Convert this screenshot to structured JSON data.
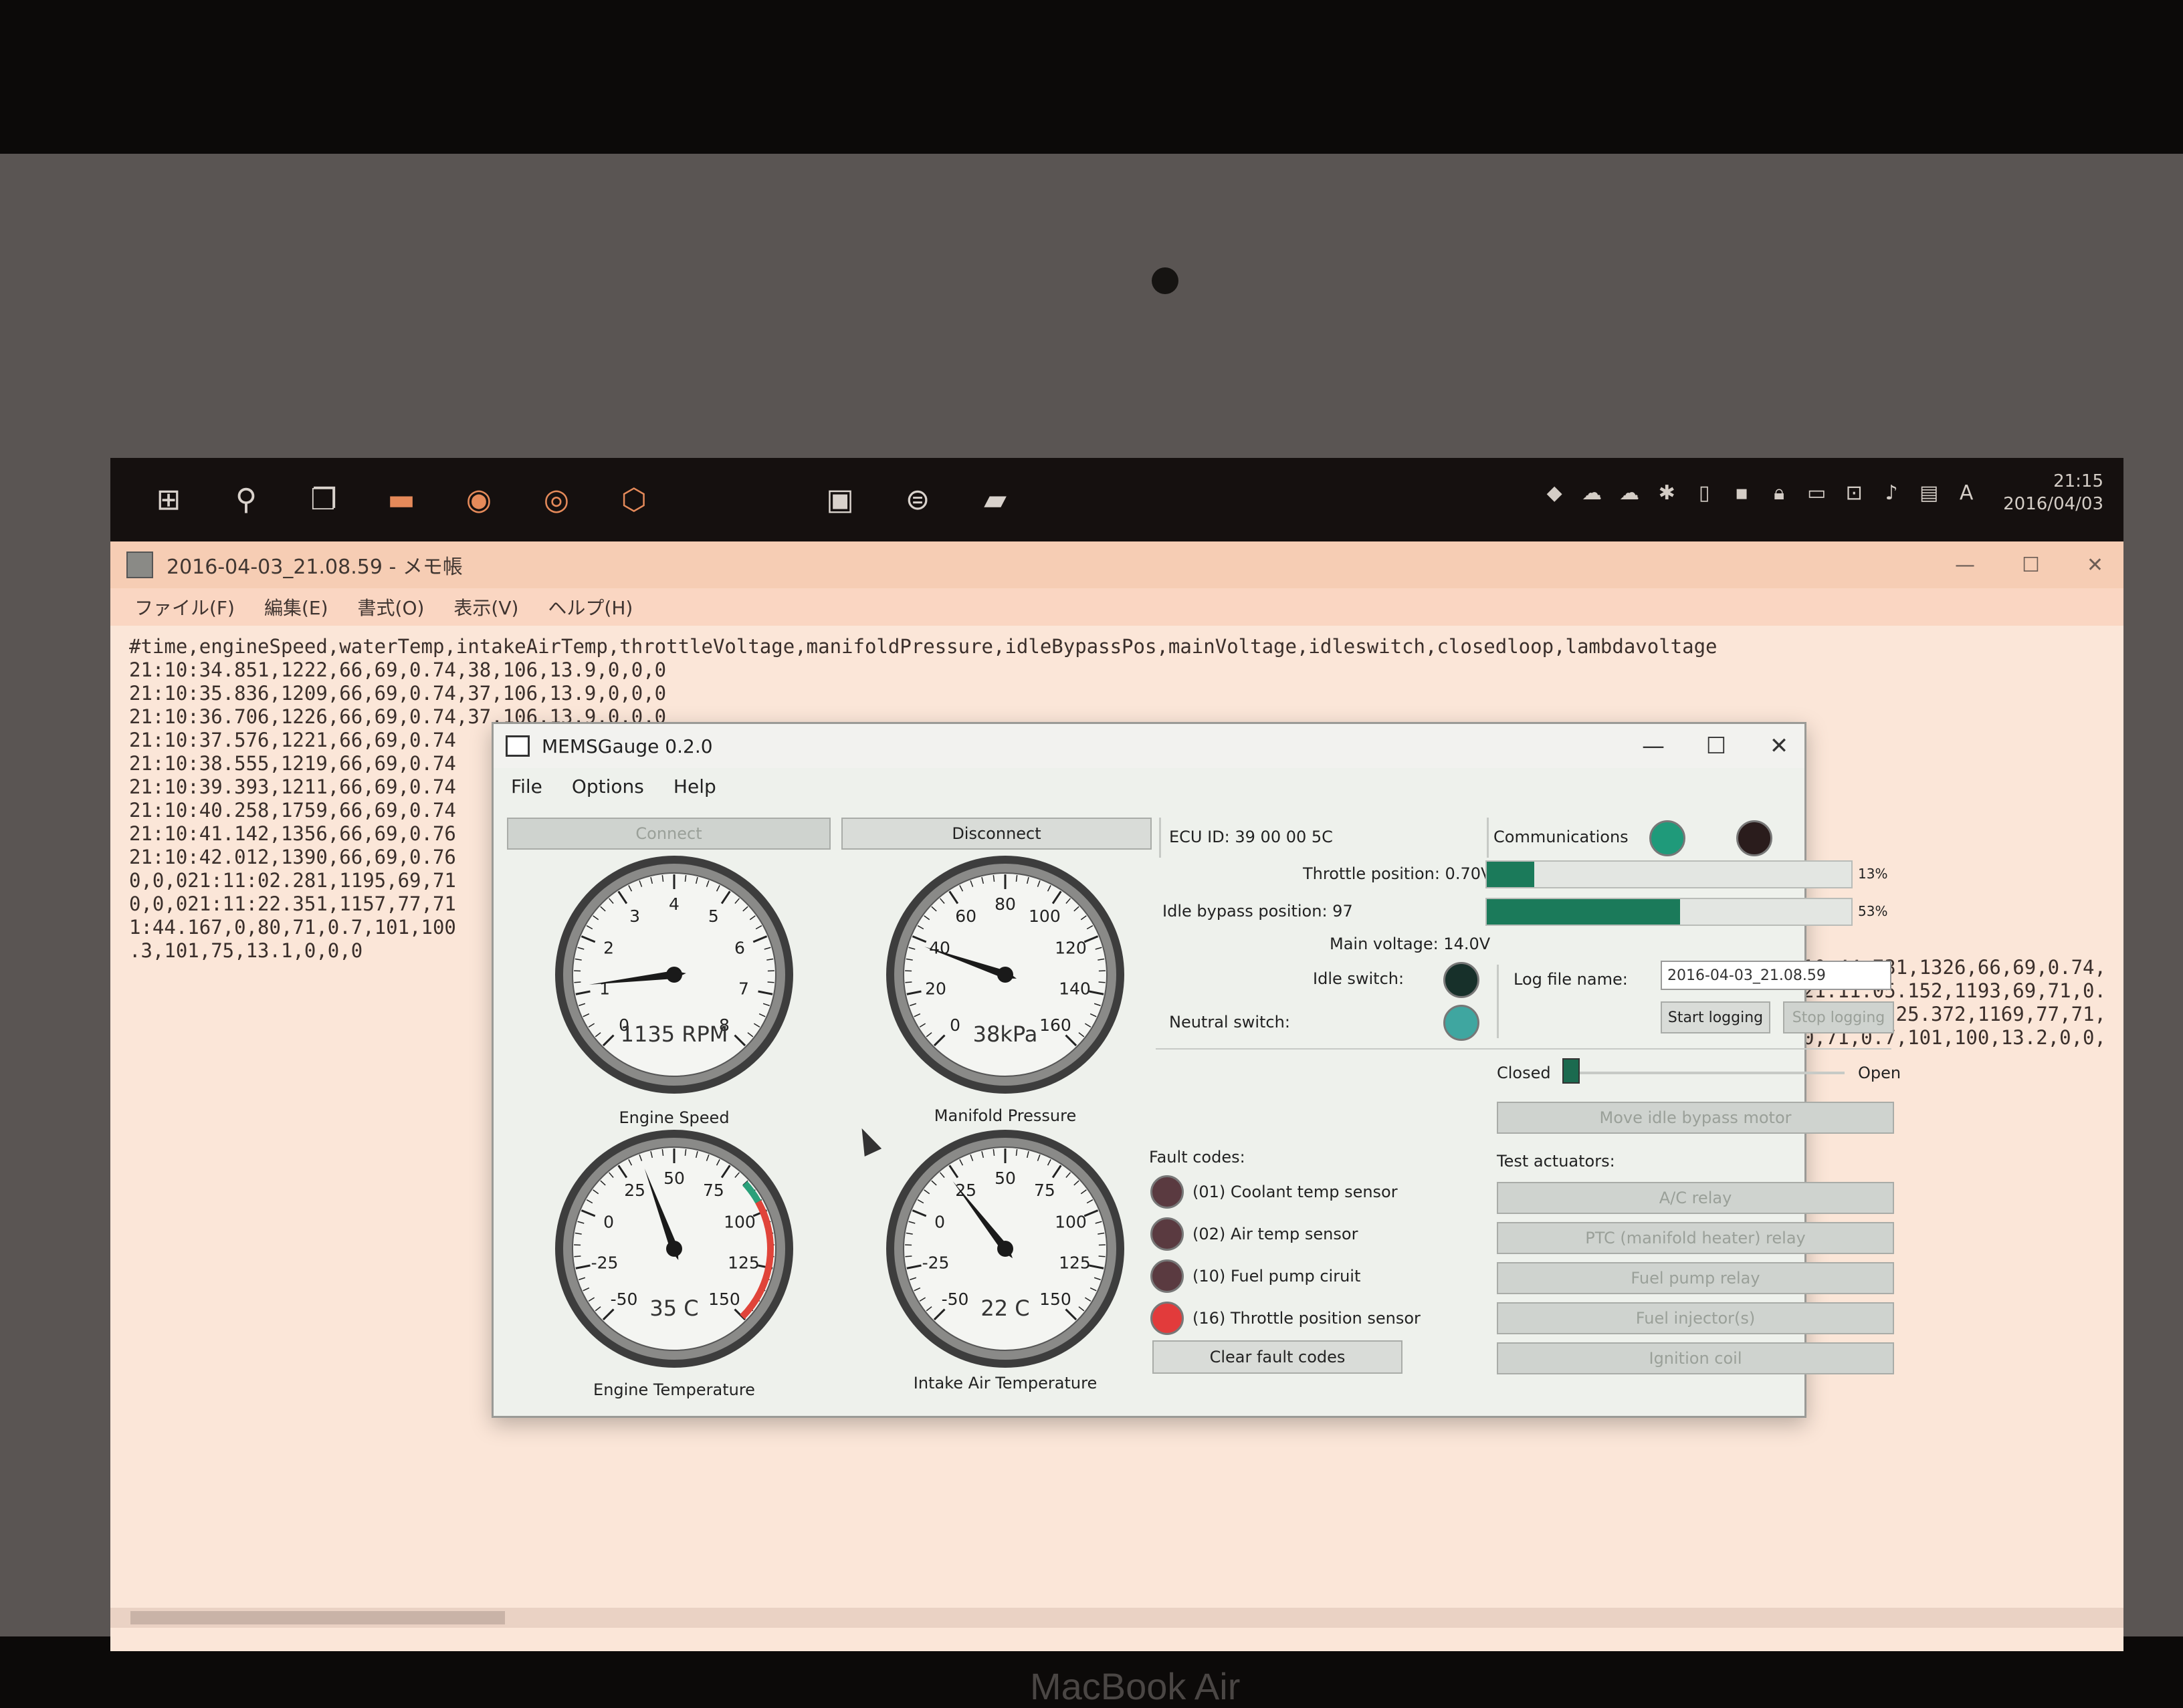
{
  "device": {
    "brand": "MacBook Air"
  },
  "taskbar": {
    "icons": [
      "windows-icon",
      "search-icon",
      "task-view-icon",
      "file-explorer-icon",
      "chrome-icon",
      "firefox-icon",
      "paint-icon",
      "panel-icon",
      "network-app-icon",
      "tablet-icon"
    ],
    "clock_time": "21:15",
    "clock_date": "2016/04/03"
  },
  "notepad": {
    "title": "2016-04-03_21.08.59 - メモ帳",
    "menu": [
      "ファイル(F)",
      "編集(E)",
      "書式(O)",
      "表示(V)",
      "ヘルプ(H)"
    ],
    "lines": [
      "#time,engineSpeed,waterTemp,intakeAirTemp,throttleVoltage,manifoldPressure,idleBypassPos,mainVoltage,idleswitch,closedloop,lambdavoltage",
      "21:10:34.851,1222,66,69,0.74,38,106,13.9,0,0,0",
      "21:10:35.836,1209,66,69,0.74,37,106,13.9,0,0,0",
      "21:10:36.706,1226,66,69,0.74,37,106,13.9,0,0,0",
      "21:10:37.576,1221,66,69,0.74",
      "21:10:38.555,1219,66,69,0.74",
      "21:10:39.393,1211,66,69,0.74",
      "21:10:40.258,1759,66,69,0.74",
      "21:10:41.142,1356,66,69,0.76",
      "21:10:42.012,1390,66,69,0.76",
      "0,0,021:11:02.281,1195,69,71",
      "0,0,021:11:22.351,1157,77,71",
      "1:44.167,0,80,71,0.7,101,100",
      ".3,101,75,13.1,0,0,0"
    ],
    "right_lines": [
      "10:44.731,1326,66,69,0.74,",
      "21:11:05.152,1193,69,71,0.",
      ",021:11:25.372,1169,77,71,",
      "0,71,0.7,101,100,13.2,0,0,"
    ]
  },
  "app": {
    "title": "MEMSGauge 0.2.0",
    "menu": [
      "File",
      "Options",
      "Help"
    ],
    "connect_label": "Connect",
    "disconnect_label": "Disconnect",
    "ecu_id": "ECU ID: 39 00 00 5C",
    "communications_label": "Communications",
    "throttle_label": "Throttle position: 0.70V",
    "throttle_pct_label": "13%",
    "idle_bypass_label": "Idle bypass position: 97",
    "idle_bypass_pct_label": "53%",
    "main_voltage_label": "Main voltage: 14.0V",
    "idle_switch_label": "Idle switch:",
    "neutral_switch_label": "Neutral switch:",
    "log_file_label": "Log file name:",
    "log_file_value": "2016-04-03_21.08.59",
    "start_logging_label": "Start logging",
    "stop_logging_label": "Stop logging",
    "closed_label": "Closed",
    "open_label": "Open",
    "move_idle_label": "Move idle bypass motor",
    "test_actuators_label": "Test actuators:",
    "actuators": [
      "A/C relay",
      "PTC (manifold heater) relay",
      "Fuel pump relay",
      "Fuel injector(s)",
      "Ignition coil"
    ],
    "fault_codes_label": "Fault codes:",
    "faults": [
      {
        "label": "(01) Coolant temp sensor",
        "color": "#5a3a40"
      },
      {
        "label": "(02) Air temp sensor",
        "color": "#5a3a40"
      },
      {
        "label": "(10) Fuel pump ciruit",
        "color": "#5a3a40"
      },
      {
        "label": "(16) Throttle position sensor",
        "color": "#e23b3b"
      }
    ],
    "clear_faults_label": "Clear fault codes",
    "colors": {
      "bar_fill": "#1b7a5a",
      "comm_rx": "#1f9a7a",
      "comm_tx": "#2a1c1c",
      "idle_led": "#17302a",
      "neutral_led": "#3fa6a0"
    },
    "gauges": [
      {
        "caption": "Engine Speed",
        "readout": "1135 RPM",
        "min": 0,
        "max": 8,
        "ticks": [
          "0",
          "1",
          "2",
          "3",
          "4",
          "5",
          "6",
          "7",
          "8"
        ],
        "value": 1.135
      },
      {
        "caption": "Manifold Pressure",
        "readout": "38kPa",
        "min": 0,
        "max": 160,
        "ticks": [
          "0",
          "20",
          "40",
          "60",
          "80",
          "100",
          "120",
          "140",
          "160"
        ],
        "value": 38
      },
      {
        "caption": "Engine Temperature",
        "readout": "35 C",
        "min": -50,
        "max": 150,
        "ticks": [
          "-50",
          "-25",
          "0",
          "25",
          "50",
          "75",
          "100",
          "125",
          "150"
        ],
        "value": 35
      },
      {
        "caption": "Intake Air Temperature",
        "readout": "22 C",
        "min": -50,
        "max": 150,
        "ticks": [
          "-50",
          "-25",
          "0",
          "25",
          "50",
          "75",
          "100",
          "125",
          "150"
        ],
        "value": 22
      }
    ]
  }
}
